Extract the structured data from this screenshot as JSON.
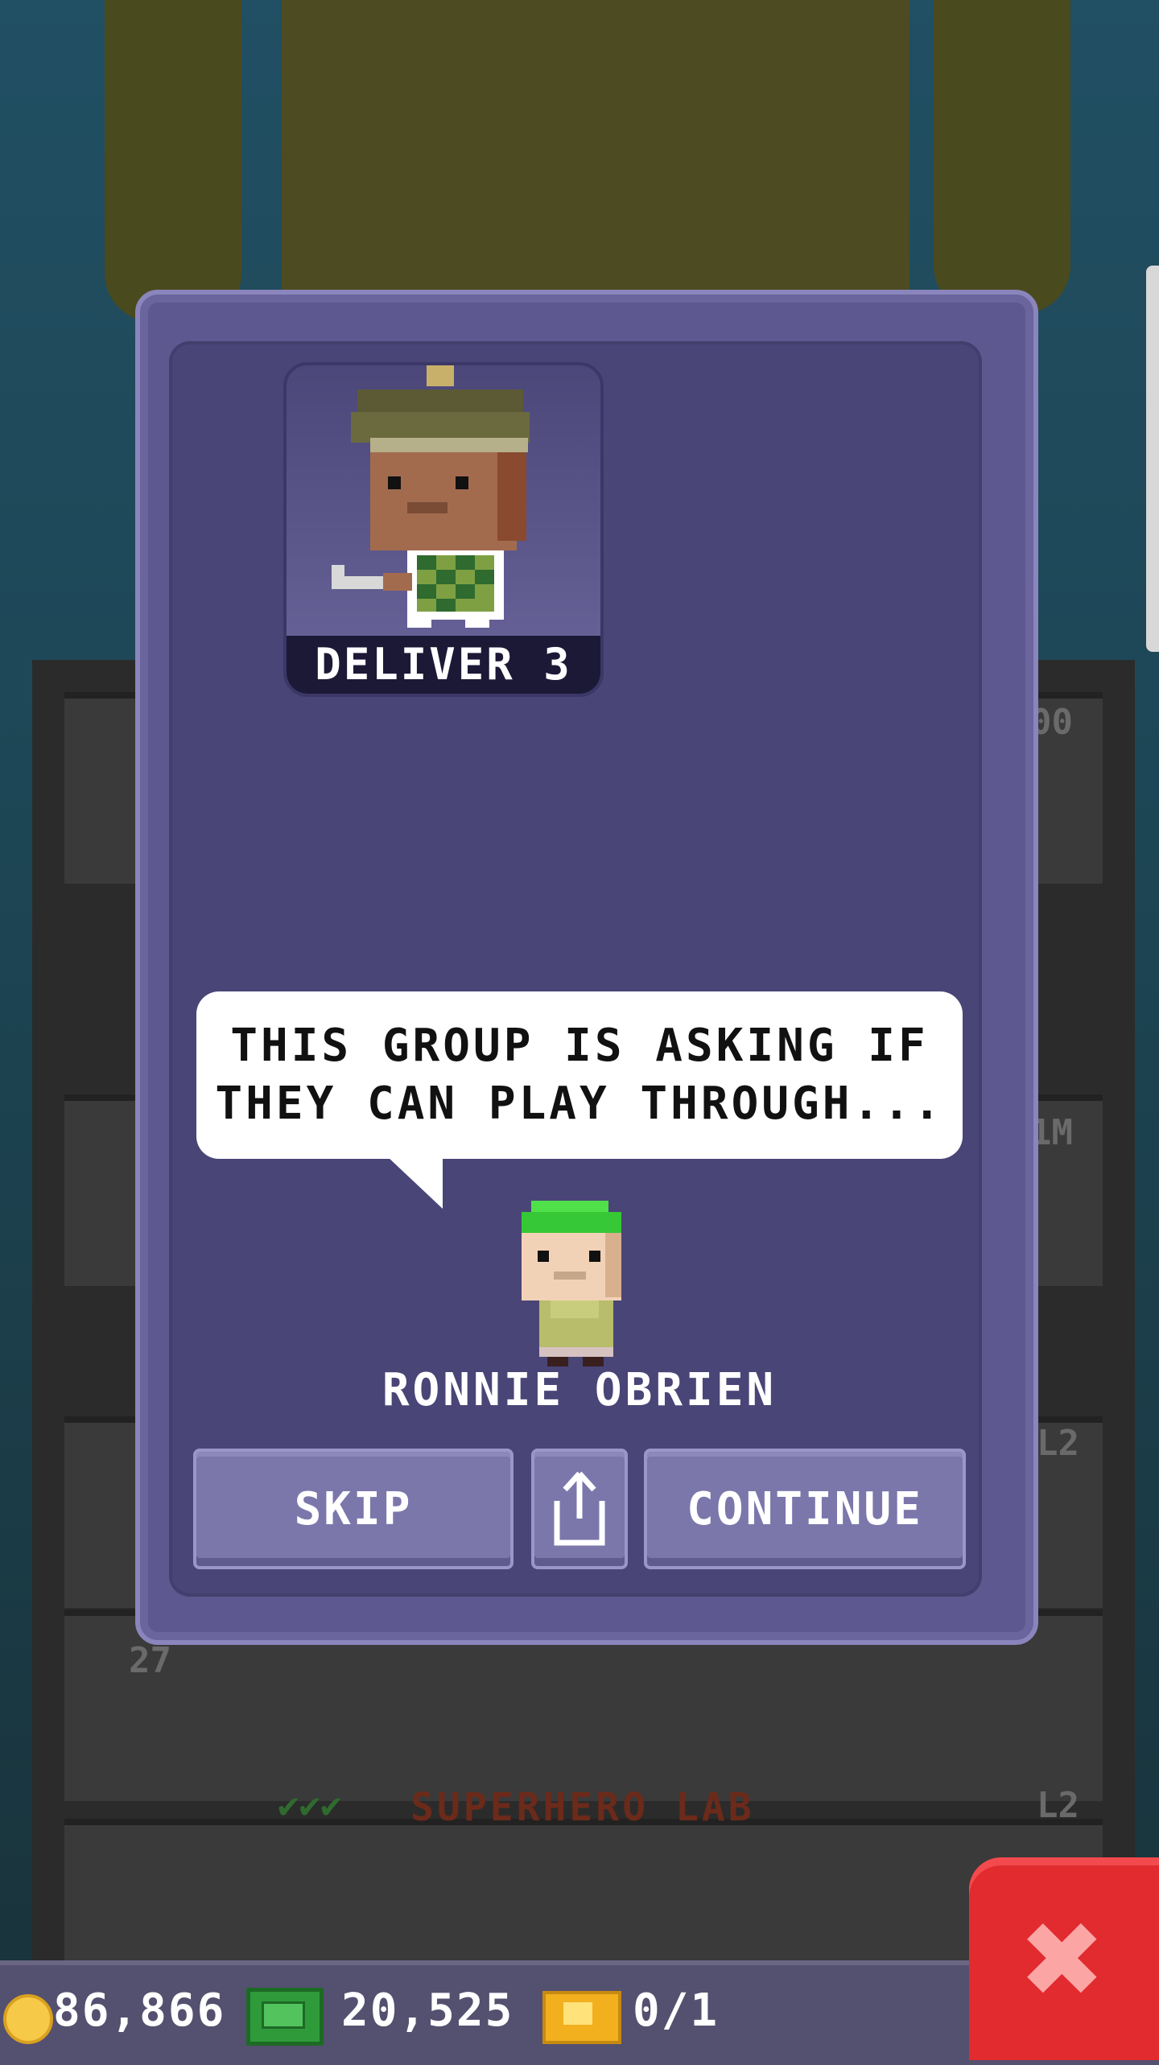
{
  "background": {
    "floors": [
      {
        "label": "00"
      },
      {
        "label": "1M"
      },
      {
        "label": "L2"
      },
      {
        "label": "27"
      },
      {
        "label": "L2"
      }
    ],
    "lab": {
      "checks": "✔✔✔",
      "name": "SUPERHERO LAB"
    }
  },
  "dialog": {
    "mission_label": "DELIVER 3",
    "message_line1": "THIS GROUP IS ASKING IF",
    "message_line2": "THEY CAN PLAY THROUGH...",
    "character_name": "RONNIE OBRIEN",
    "buttons": {
      "skip": "SKIP",
      "continue": "CONTINUE"
    }
  },
  "hud": {
    "coins": "86,866",
    "bux": "20,525",
    "tickets": "0/1"
  },
  "colors": {
    "modal": "#5e5890",
    "modal_inner": "#4a4577",
    "button": "#7b77ab",
    "close": "#e12b2f"
  },
  "icons": [
    "coin-icon",
    "bux-icon",
    "ticket-icon",
    "share-icon",
    "close-icon"
  ]
}
